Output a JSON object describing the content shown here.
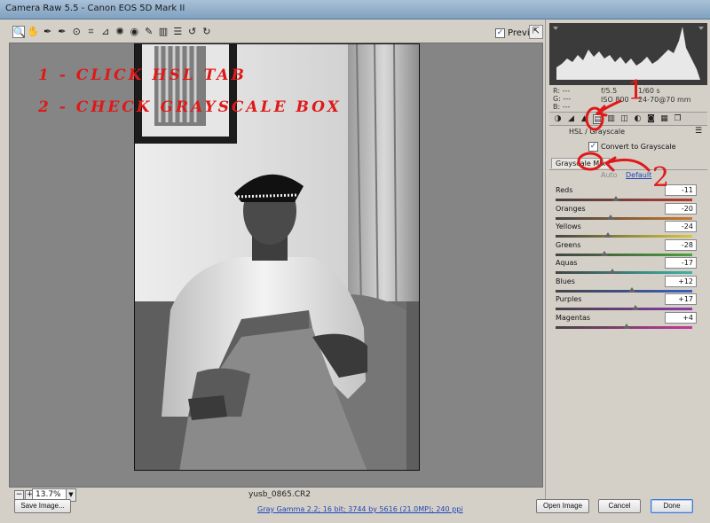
{
  "window": {
    "title": "Camera Raw 5.5  -  Canon EOS 5D Mark II"
  },
  "toolbar": {
    "tools": [
      {
        "name": "zoom-tool",
        "glyph": "🔍",
        "active": true
      },
      {
        "name": "hand-tool",
        "glyph": "✋"
      },
      {
        "name": "white-balance-tool",
        "glyph": "✒"
      },
      {
        "name": "color-sampler-tool",
        "glyph": "✒"
      },
      {
        "name": "targeted-adjustment-tool",
        "glyph": "⊙"
      },
      {
        "name": "crop-tool",
        "glyph": "⌗"
      },
      {
        "name": "straighten-tool",
        "glyph": "⊿"
      },
      {
        "name": "spot-removal-tool",
        "glyph": "✺"
      },
      {
        "name": "red-eye-tool",
        "glyph": "◉"
      },
      {
        "name": "adjustment-brush-tool",
        "glyph": "✎"
      },
      {
        "name": "graduated-filter-tool",
        "glyph": "▥"
      },
      {
        "name": "preferences-tool",
        "glyph": "☰"
      },
      {
        "name": "rotate-ccw-tool",
        "glyph": "↺"
      },
      {
        "name": "rotate-cw-tool",
        "glyph": "↻"
      }
    ],
    "preview_label": "Preview",
    "preview_checked": true
  },
  "annotations": {
    "line1": "1 - CLICK HSL TAB",
    "line2": "2 - CHECK GRAYSCALE BOX",
    "marker1": "1",
    "marker2": "2",
    "color": "#e01818"
  },
  "zoom": {
    "value": "13.7%",
    "minus": "−",
    "plus": "+"
  },
  "file": {
    "name": "yusb_0865.CR2"
  },
  "histogram": {
    "readout": {
      "r": "R:  ---",
      "g": "G:  ---",
      "b": "B:  ---"
    },
    "exif": {
      "aperture": "f/5.5",
      "shutter": "1/60 s",
      "iso": "ISO 800",
      "lens": "24-70@70 mm"
    }
  },
  "panel_tabs": [
    {
      "name": "basic-tab-icon",
      "glyph": "◑"
    },
    {
      "name": "tone-curve-tab-icon",
      "glyph": "◢"
    },
    {
      "name": "detail-tab-icon",
      "glyph": "▲"
    },
    {
      "name": "hsl-grayscale-tab-icon",
      "glyph": "▤",
      "selected": true
    },
    {
      "name": "split-toning-tab-icon",
      "glyph": "▥"
    },
    {
      "name": "lens-corrections-tab-icon",
      "glyph": "◫"
    },
    {
      "name": "effects-tab-icon",
      "glyph": "◐"
    },
    {
      "name": "camera-calibration-tab-icon",
      "glyph": "◙"
    },
    {
      "name": "presets-tab-icon",
      "glyph": "▦"
    },
    {
      "name": "snapshots-tab-icon",
      "glyph": "❐"
    }
  ],
  "hsl": {
    "title": "HSL / Grayscale",
    "convert_label": "Convert to Grayscale",
    "convert_checked": true,
    "subtab": "Grayscale Mix",
    "auto": "Auto",
    "default": "Default",
    "sliders": [
      {
        "label": "Reds",
        "value": "-11",
        "fraction": 0.44,
        "gradient": "linear-gradient(to right,#444,#b23a2e)"
      },
      {
        "label": "Oranges",
        "value": "-20",
        "fraction": 0.4,
        "gradient": "linear-gradient(to right,#444,#c77a2c)"
      },
      {
        "label": "Yellows",
        "value": "-24",
        "fraction": 0.38,
        "gradient": "linear-gradient(to right,#444,#d8c83a)"
      },
      {
        "label": "Greens",
        "value": "-28",
        "fraction": 0.36,
        "gradient": "linear-gradient(to right,#444,#4ca03c)"
      },
      {
        "label": "Aquas",
        "value": "-17",
        "fraction": 0.415,
        "gradient": "linear-gradient(to right,#444,#3ab5a8)"
      },
      {
        "label": "Blues",
        "value": "+12",
        "fraction": 0.56,
        "gradient": "linear-gradient(to right,#444,#3a5fc0)"
      },
      {
        "label": "Purples",
        "value": "+17",
        "fraction": 0.585,
        "gradient": "linear-gradient(to right,#444,#8a3ab0)"
      },
      {
        "label": "Magentas",
        "value": "+4",
        "fraction": 0.52,
        "gradient": "linear-gradient(to right,#444,#c03a9a)"
      }
    ]
  },
  "footer": {
    "save": "Save Image...",
    "info": "Gray Gamma 2.2; 16 bit; 3744 by 5616 (21.0MP); 240 ppi",
    "open": "Open Image",
    "cancel": "Cancel",
    "done": "Done"
  }
}
